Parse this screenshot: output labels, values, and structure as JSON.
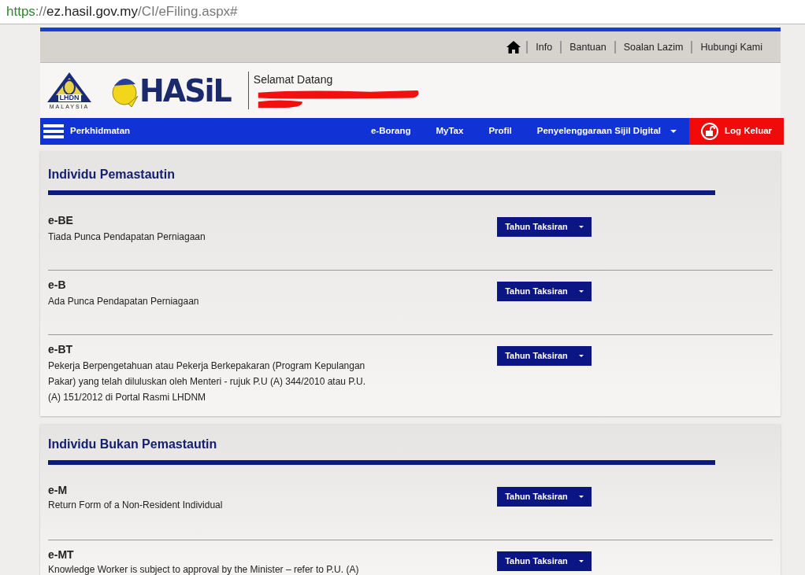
{
  "address_bar": {
    "scheme": "https",
    "separator": "://",
    "host": "ez.hasil.gov.my",
    "path": "/CI/eFiling.aspx#"
  },
  "top_links": [
    "Info",
    "Bantuan",
    "Soalan Lazim",
    "Hubungi Kami"
  ],
  "logo": {
    "agency": "LHDN",
    "country": "MALAYSIA",
    "brand": "HASiL"
  },
  "welcome": "Selamat Datang",
  "nav": {
    "menu": "Perkhidmatan",
    "links": [
      {
        "label": "e-Borang",
        "dropdown": false
      },
      {
        "label": "MyTax",
        "dropdown": false
      },
      {
        "label": "Profil",
        "dropdown": false
      },
      {
        "label": "Penyelenggaraan Sijil Digital",
        "dropdown": true
      }
    ],
    "logout": "Log Keluar"
  },
  "sections": [
    {
      "title": "Individu Pemastautin",
      "forms": [
        {
          "code": "e-BE",
          "description": "Tiada Punca Pendapatan Perniagaan",
          "button": "Tahun Taksiran"
        },
        {
          "code": "e-B",
          "description": "Ada Punca Pendapatan Perniagaan",
          "button": "Tahun Taksiran"
        },
        {
          "code": "e-BT",
          "description": "Pekerja Berpengetahuan atau Pekerja Berkepakaran (Program Kepulangan Pakar) yang telah diluluskan oleh Menteri - rujuk P.U (A) 344/2010 atau P.U. (A) 151/2012 di Portal Rasmi LHDNM",
          "button": "Tahun Taksiran"
        }
      ]
    },
    {
      "title": "Individu Bukan Pemastautin",
      "forms": [
        {
          "code": "e-M",
          "description": "Return Form of a Non-Resident Individual",
          "button": "Tahun Taksiran"
        },
        {
          "code": "e-MT",
          "description": "Knowledge Worker is subject to approval by the Minister – refer to P.U. (A)",
          "button": "Tahun Taksiran"
        }
      ]
    }
  ]
}
